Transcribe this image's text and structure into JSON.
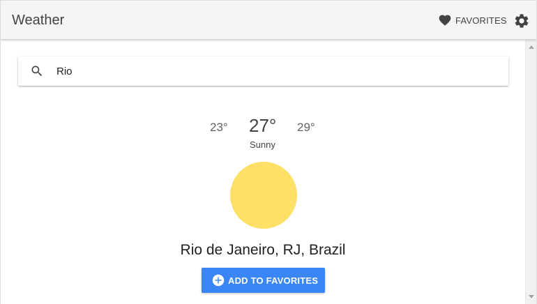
{
  "header": {
    "title": "Weather",
    "favorites_label": "FAVORITES"
  },
  "search": {
    "value": "Rio"
  },
  "weather": {
    "temp_low": "23°",
    "temp_current": "27°",
    "temp_high": "29°",
    "condition": "Sunny",
    "location": "Rio de Janeiro, RJ, Brazil"
  },
  "actions": {
    "add_favorite_label": "ADD TO FAVORITES"
  },
  "icons": {
    "favorites": "heart-icon",
    "settings": "gear-icon",
    "search": "search-icon",
    "add": "plus-circle-icon",
    "weather": "sun-icon"
  },
  "colors": {
    "sun": "#ffe066",
    "primary_button": "#3b86f7",
    "header_bg": "#f5f5f5",
    "icon_dark": "#424242"
  }
}
